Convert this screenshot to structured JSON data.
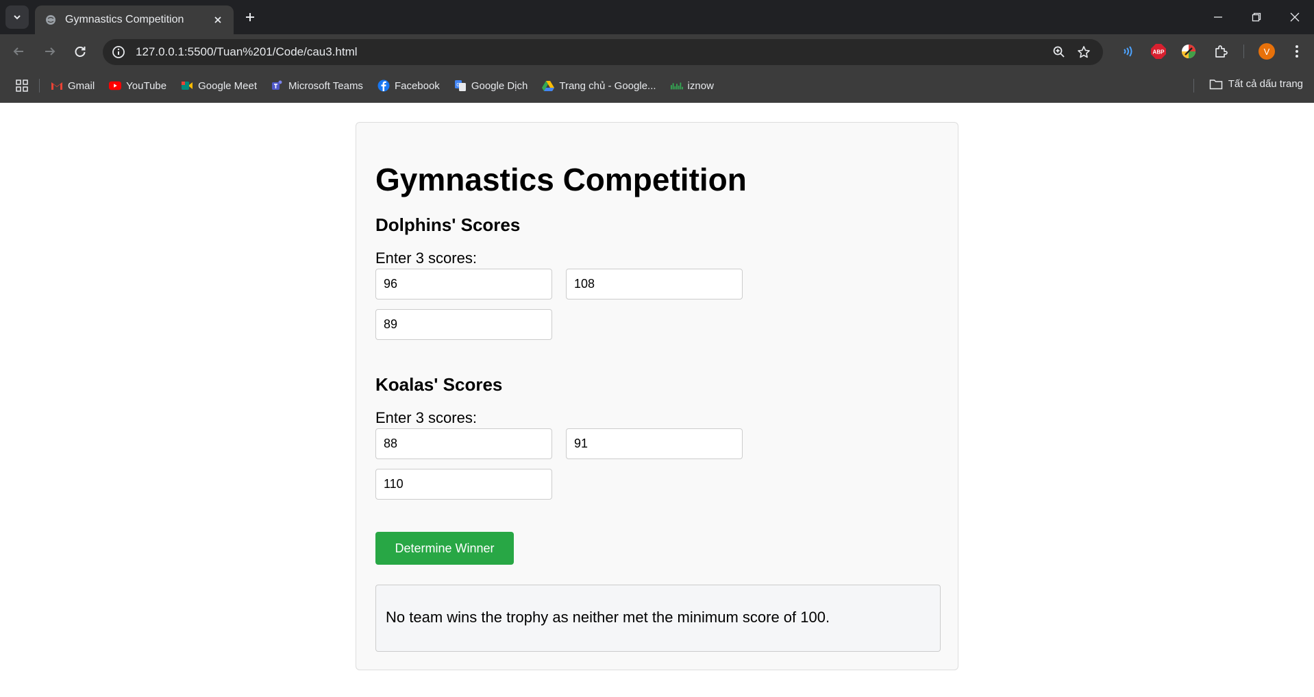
{
  "browser": {
    "tab": {
      "title": "Gymnastics Competition"
    },
    "address_bar": {
      "url": "127.0.0.1:5500/Tuan%201/Code/cau3.html"
    },
    "profile_initial": "V",
    "extension_abp_label": "ABP",
    "bookmarks": [
      {
        "label": "Gmail",
        "icon": "gmail-icon"
      },
      {
        "label": "YouTube",
        "icon": "youtube-icon"
      },
      {
        "label": "Google Meet",
        "icon": "google-meet-icon"
      },
      {
        "label": "Microsoft Teams",
        "icon": "microsoft-teams-icon"
      },
      {
        "label": "Facebook",
        "icon": "facebook-icon"
      },
      {
        "label": "Google Dịch",
        "icon": "google-translate-icon"
      },
      {
        "label": "Trang chủ - Google...",
        "icon": "google-drive-icon"
      },
      {
        "label": "iznow",
        "icon": "iznow-icon"
      }
    ],
    "all_bookmarks_label": "Tất cả dấu trang",
    "colors": {
      "tabstrip": "#202124",
      "toolbar": "#3c3c3c",
      "profile": "#e8710a",
      "abp": "#d8202f"
    }
  },
  "app": {
    "title": "Gymnastics Competition",
    "dolphins": {
      "heading": "Dolphins' Scores",
      "prompt": "Enter 3 scores:",
      "scores": [
        "96",
        "108",
        "89"
      ]
    },
    "koalas": {
      "heading": "Koalas' Scores",
      "prompt": "Enter 3 scores:",
      "scores": [
        "88",
        "91",
        "110"
      ]
    },
    "button_label": "Determine Winner",
    "result": "No team wins the trophy as neither met the minimum score of 100.",
    "colors": {
      "button": "#28a745",
      "card_bg": "#f9f9f9"
    }
  }
}
